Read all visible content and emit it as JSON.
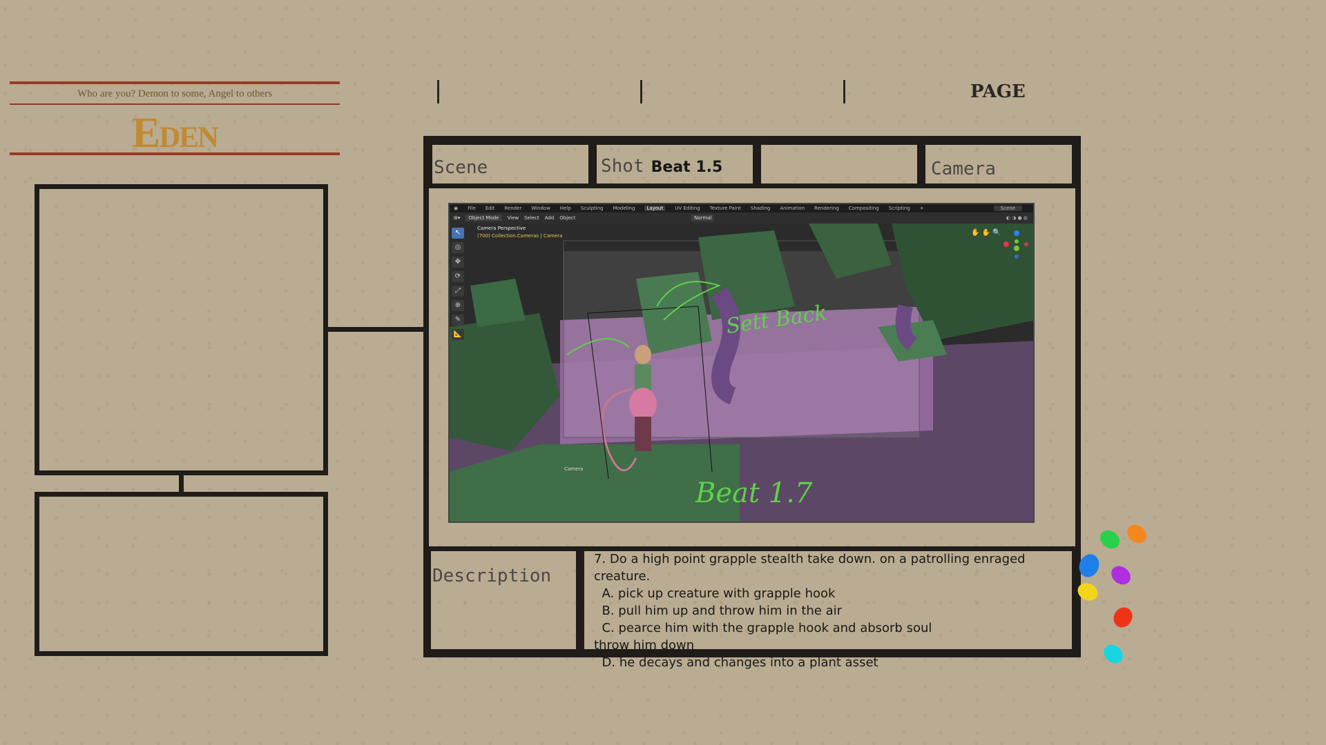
{
  "header": {
    "tagline": "Who are you? Demon to some, Angel to others",
    "logo": "Eden",
    "page_label": "PAGE"
  },
  "shot_table": {
    "scene_label": "Scene",
    "shot_label": "Shot",
    "shot_value": "Beat 1.5",
    "empty_label": "",
    "camera_label": "Camera",
    "description_label": "Description"
  },
  "blender": {
    "menu": [
      "File",
      "Edit",
      "Render",
      "Window",
      "Help"
    ],
    "workspaces": [
      "Sculpting",
      "Modeling",
      "Layout",
      "UV Editing",
      "Texture Paint",
      "Shading",
      "Animation",
      "Rendering",
      "Compositing",
      "Scripting"
    ],
    "active_workspace": "Layout",
    "scene_name": "Scene",
    "mode": "Object Mode",
    "header_menu": [
      "View",
      "Select",
      "Add",
      "Object"
    ],
    "transform_orientation": "Normal",
    "view_title": "Camera Perspective",
    "view_subtitle": "(700) Collection.Cameras | Camera",
    "camera_name": "Camera",
    "annotation_top": "Sett Back",
    "annotation_bottom": "Beat 1.7"
  },
  "description": {
    "lines": [
      "7. Do a high point grapple stealth take down. on a patrolling enraged",
      "creature.",
      "  A. pick up creature with grapple hook",
      "  B. pull him up and throw him in the air",
      "  C. pearce him with the grapple hook and absorb soul",
      "throw him down",
      "  D. he decays and changes into a plant asset"
    ]
  },
  "palette_colors": [
    "#27d14a",
    "#f5871f",
    "#1f7fe8",
    "#b02de0",
    "#f2d51b",
    "#ee3319",
    "#19d5e0"
  ]
}
